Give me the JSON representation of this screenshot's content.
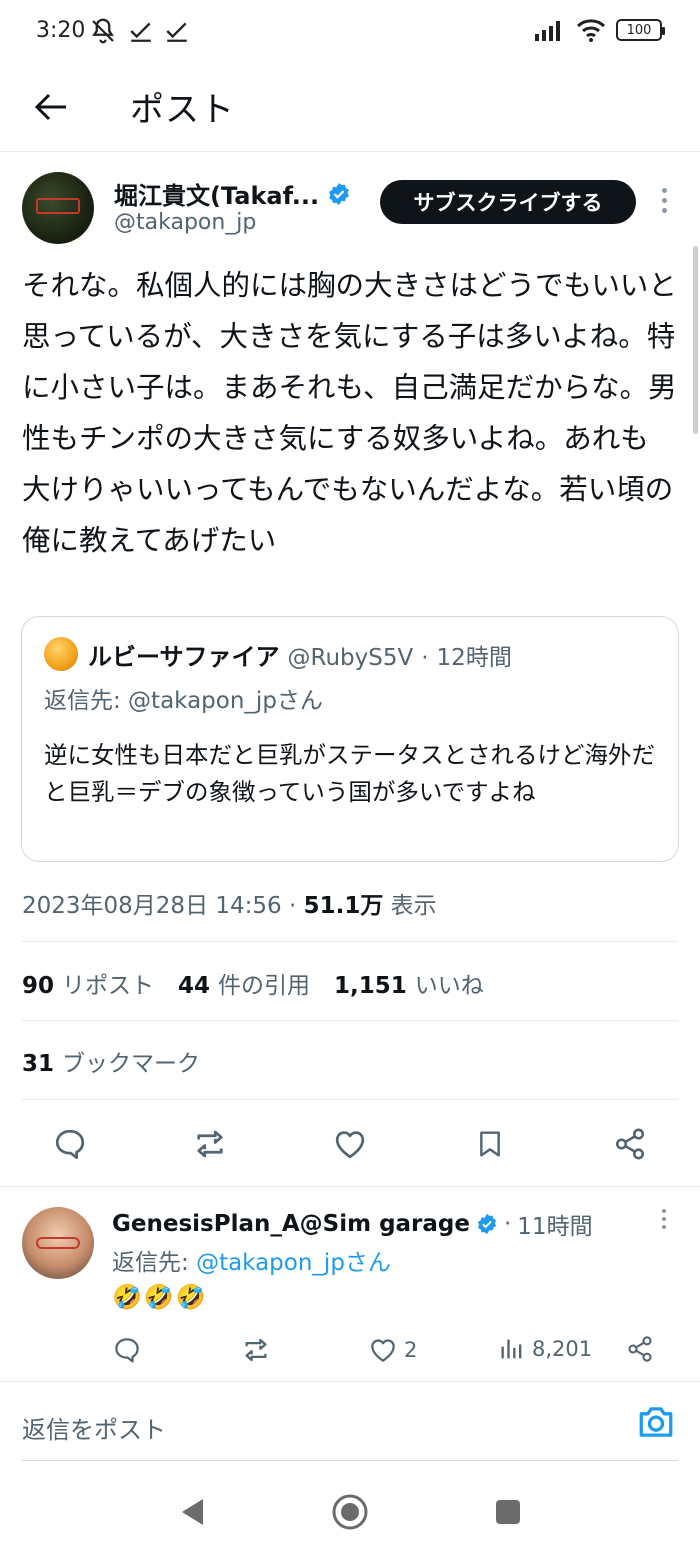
{
  "status_bar": {
    "time": "3:20",
    "battery": "100"
  },
  "header": {
    "title": "ポスト"
  },
  "post": {
    "author_name": "堀江貴文(Takaf...",
    "author_handle": "@takapon_jp",
    "subscribe_label": "サブスクライブする",
    "text": "それな。私個人的には胸の大きさはどうでもいいと思っているが、大きさを気にする子は多いよね。特に小さい子は。まあそれも、自己満足だからな。男性もチンポの大きさ気にする奴多いよね。あれも大けりゃいいってもんでもないんだよな。若い頃の俺に教えてあげたい",
    "timestamp": "2023年08月28日 14:56",
    "separator": " · ",
    "views": "51.1万",
    "views_label": "表示"
  },
  "quote": {
    "name": "ルビーサファイア",
    "handle": "@RubyS5V",
    "dot": "·",
    "time": "12時間",
    "reply_to": "返信先: @takapon_jpさん",
    "text": "逆に女性も日本だと巨乳がステータスとされるけど海外だと巨乳＝デブの象徴っていう国が多いですよね"
  },
  "stats": {
    "reposts_count": "90",
    "reposts_label": "リポスト",
    "quotes_count": "44",
    "quotes_label": "件の引用",
    "likes_count": "1,151",
    "likes_label": "いいね",
    "bookmarks_count": "31",
    "bookmarks_label": "ブックマーク"
  },
  "reply": {
    "name": "GenesisPlan_A@Sim garage",
    "dot": "·",
    "time": "11時間",
    "reply_prefix": "返信先: ",
    "reply_handle": "@takapon_jpさん",
    "text": "🤣🤣🤣",
    "likes": "2",
    "views": "8,201"
  },
  "compose": {
    "placeholder": "返信をポスト"
  },
  "colors": {
    "accent": "#1d9bf0",
    "text": "#0f1419",
    "muted": "#536471"
  }
}
